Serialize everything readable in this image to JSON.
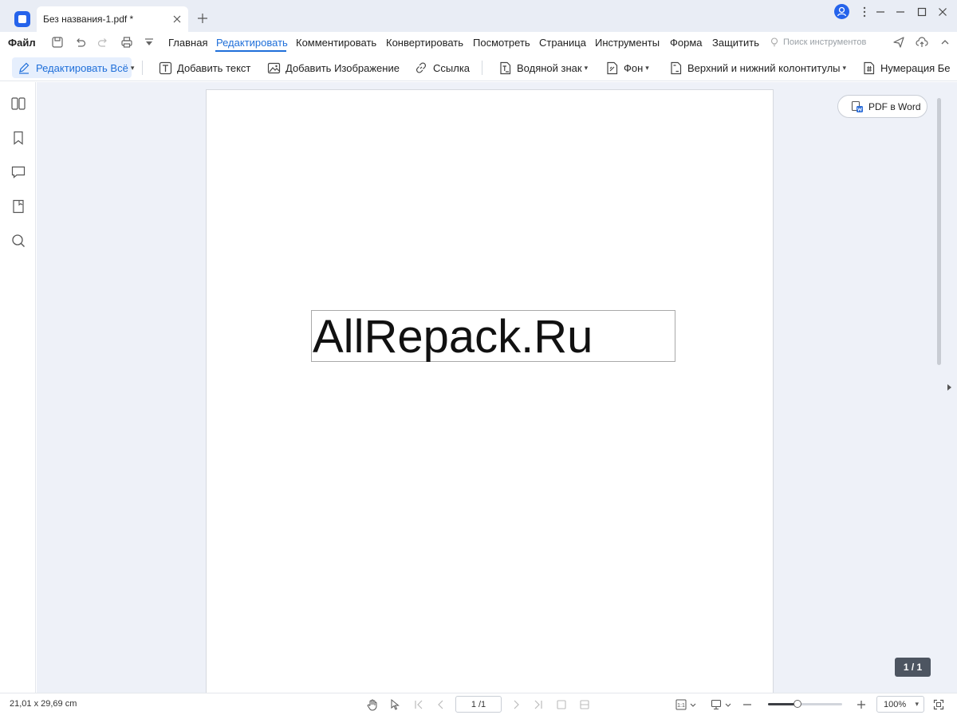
{
  "titlebar": {
    "tab_title": "Без названия-1.pdf *",
    "icons": [
      "app-logo-icon",
      "close-icon",
      "plus-icon",
      "user-icon",
      "more-vertical-icon",
      "minimize-icon",
      "maximize-icon",
      "close-window-icon"
    ]
  },
  "menu": {
    "file": "Файл",
    "items": [
      "Главная",
      "Редактировать",
      "Комментировать",
      "Конвертировать",
      "Посмотреть",
      "Страница",
      "Инструменты",
      "Форма",
      "Защитить"
    ],
    "active": "Редактировать",
    "search_placeholder": "Поиск инструментов",
    "quick_access_icons": [
      "save-icon",
      "undo-icon",
      "redo-icon",
      "print-icon",
      "dropdown-icon"
    ],
    "right_icons": [
      "share-icon",
      "cloud-upload-icon",
      "expand-icon"
    ]
  },
  "toolbar": {
    "edit_all": "Редактировать Всё",
    "add_text": "Добавить текст",
    "add_image": "Добавить Изображение",
    "link": "Ссылка",
    "watermark": "Водяной знак",
    "background": "Фон",
    "header_footer": "Верхний и нижний колонтитулы",
    "bates": "Нумерация Бе"
  },
  "left_panel": {
    "icons": [
      "thumbnails-icon",
      "bookmark-icon",
      "comment-icon",
      "attachment-icon",
      "search-icon"
    ]
  },
  "document": {
    "text": "AllRepack.Ru",
    "pdf_to_word": "PDF в Word",
    "page_badge": "1 / 1"
  },
  "status": {
    "page_size": "21,01 x 29,69 cm",
    "page_input": "1 /1",
    "zoom": "100%",
    "zoom_fraction": 0.4
  },
  "colors": {
    "accent": "#1f6fd9",
    "titlebar_bg": "#e9edf5",
    "canvas_bg": "#eef1f8"
  }
}
